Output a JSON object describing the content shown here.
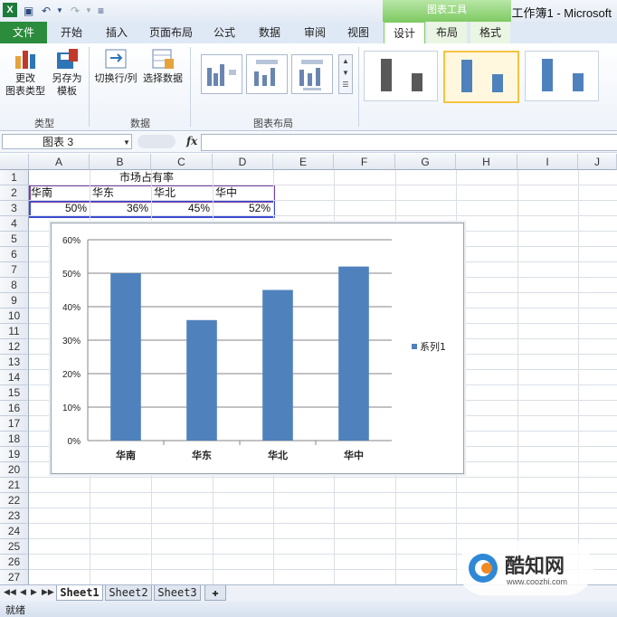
{
  "window": {
    "title": "工作簿1 - Microsoft"
  },
  "ribbon": {
    "context_label": "图表工具",
    "tabs": [
      "文件",
      "开始",
      "插入",
      "页面布局",
      "公式",
      "数据",
      "审阅",
      "视图",
      "设计",
      "布局",
      "格式"
    ],
    "groups": {
      "type": {
        "label": "类型",
        "change_type": "更改\n图表类型",
        "save_template": "另存为\n模板"
      },
      "data": {
        "label": "数据",
        "switch_row_col": "切换行/列",
        "select_data": "选择数据"
      },
      "layout": {
        "label": "图表布局"
      }
    }
  },
  "formula_bar": {
    "name_box": "图表 3",
    "fx": "fx",
    "value": ""
  },
  "sheet": {
    "columns": [
      "A",
      "B",
      "C",
      "D",
      "E",
      "F",
      "G",
      "H",
      "I",
      "J"
    ],
    "rows": [
      "1",
      "2",
      "3",
      "4",
      "5",
      "6",
      "7",
      "8",
      "9",
      "10",
      "11",
      "12",
      "13",
      "14",
      "15",
      "16",
      "17",
      "18",
      "19",
      "20",
      "21",
      "22",
      "23",
      "24",
      "25",
      "26",
      "27"
    ],
    "title_cell": "市场占有率",
    "labels": [
      "华南",
      "华东",
      "华北",
      "华中"
    ],
    "values": [
      "50%",
      "36%",
      "45%",
      "52%"
    ]
  },
  "chart_data": {
    "type": "bar",
    "categories": [
      "华南",
      "华东",
      "华北",
      "华中"
    ],
    "series": [
      {
        "name": "系列1",
        "values": [
          50,
          36,
          45,
          52
        ]
      }
    ],
    "yticks": [
      "0%",
      "10%",
      "20%",
      "30%",
      "40%",
      "50%",
      "60%"
    ],
    "ylim": [
      0,
      60
    ],
    "grid": true,
    "legend": "right",
    "bar_color": "#4f81bd"
  },
  "sheet_tabs": [
    "Sheet1",
    "Sheet2",
    "Sheet3"
  ],
  "status": {
    "text": "就绪"
  },
  "watermark": {
    "brand": "酷知网",
    "url": "www.coozhi.com"
  }
}
